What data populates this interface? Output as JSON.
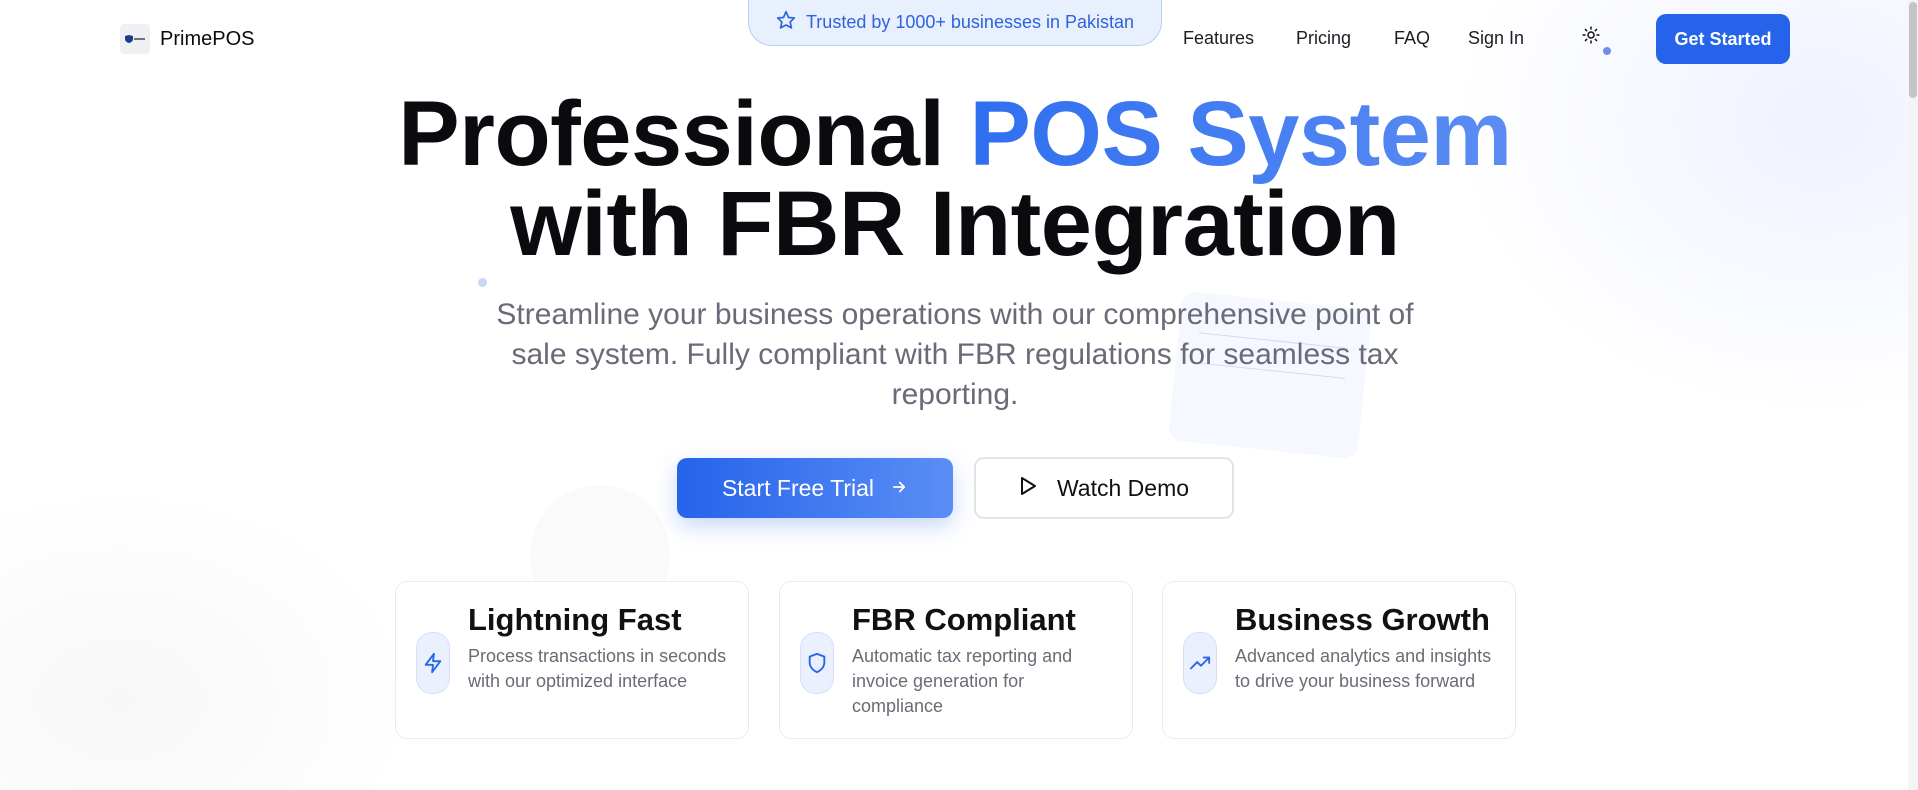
{
  "brand": {
    "name": "PrimePOS",
    "logo_icon": "shield-logo-icon"
  },
  "trust_badge": {
    "text": "Trusted by 1000+ businesses in Pakistan",
    "icon": "star-icon"
  },
  "nav": {
    "items": [
      {
        "label": "Features"
      },
      {
        "label": "Pricing"
      },
      {
        "label": "FAQ"
      },
      {
        "label": "Sign In"
      }
    ],
    "theme_toggle_icon": "sun-icon",
    "cta_label": "Get Started"
  },
  "hero": {
    "title_line1_plain": "Professional ",
    "title_line1_accent": "POS System",
    "title_line2": "with FBR Integration",
    "subtitle": "Streamline your business operations with our comprehensive point of sale system. Fully compliant with FBR regulations for seamless tax reporting.",
    "primary_cta": "Start Free Trial",
    "secondary_cta": "Watch Demo"
  },
  "features": [
    {
      "title": "Lightning Fast",
      "description": "Process transactions in seconds with our optimized interface",
      "icon": "lightning-icon"
    },
    {
      "title": "FBR Compliant",
      "description": "Automatic tax reporting and invoice generation for compliance",
      "icon": "shield-icon"
    },
    {
      "title": "Business Growth",
      "description": "Advanced analytics and insights to drive your business forward",
      "icon": "trending-up-icon"
    }
  ],
  "colors": {
    "accent": "#2563eb",
    "accent_light": "#3b82f6",
    "badge_bg": "#e9f0fd",
    "text_muted": "#6a6a78"
  }
}
